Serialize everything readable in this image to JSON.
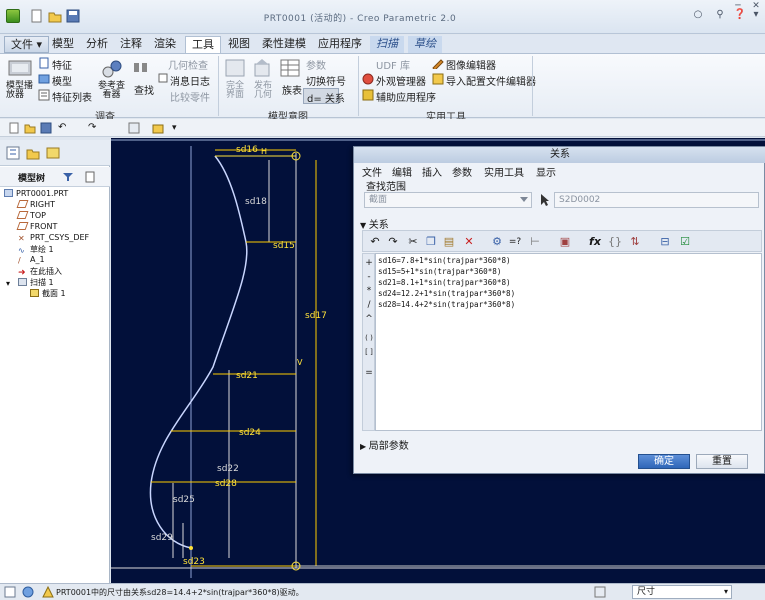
{
  "window": {
    "title": "PRT0001 (活动的) - Creo Parametric 2.0"
  },
  "ribbon_tabs": [
    {
      "label": "文件 ▾"
    },
    {
      "label": "模型"
    },
    {
      "label": "分析"
    },
    {
      "label": "注释"
    },
    {
      "label": "渲染"
    },
    {
      "label": "工具"
    },
    {
      "label": "视图"
    },
    {
      "label": "柔性建模"
    },
    {
      "label": "应用程序"
    },
    {
      "label": "扫描"
    },
    {
      "label": "草绘"
    }
  ],
  "ribbon": {
    "model_player": "模型播\n放器",
    "feature": "特征",
    "model": "模型",
    "feature_list": "特征列表",
    "reference_viewer": "参考查\n看器",
    "find": "查找",
    "geometry_check": "几何检查",
    "message_log": "消息日志",
    "compare_parts": "比较零件",
    "group_investigate": "调查",
    "complete_interface": "完全\n界面",
    "publish_geometry": "发布\n几何",
    "family_table": "族表",
    "parameters": "参数",
    "switch_symbols": "切换符号",
    "relations": "d= 关系",
    "group_model_intent": "模型意图",
    "udf_library": "UDF 库",
    "appearance_manager": "外观管理器",
    "auxiliary_app": "辅助应用程序",
    "image_editor": "图像编辑器",
    "import_config_editor": "导入配置文件编辑器",
    "group_utilities": "实用工具"
  },
  "model_tree": {
    "header": "模型树",
    "items": [
      {
        "label": "PRT0001.PRT"
      },
      {
        "label": "RIGHT"
      },
      {
        "label": "TOP"
      },
      {
        "label": "FRONT"
      },
      {
        "label": "PRT_CSYS_DEF"
      },
      {
        "label": "草绘 1"
      },
      {
        "label": "A_1"
      },
      {
        "label": "在此插入"
      },
      {
        "label": "扫描 1"
      },
      {
        "label": "截面 1"
      }
    ]
  },
  "sketch": {
    "dims": [
      "sd16",
      "sd18",
      "sd15",
      "sd17",
      "sd21",
      "sd24",
      "sd22",
      "sd28",
      "sd25",
      "sd29",
      "sd23"
    ],
    "labels": [
      "H",
      "V"
    ]
  },
  "dialog": {
    "title": "关系",
    "menu": [
      "文件",
      "编辑",
      "插入",
      "参数",
      "实用工具",
      "显示"
    ],
    "scope_label": "查找范围",
    "scope_value": "截面",
    "section_value": "S2D0002",
    "relations_label": "关系",
    "relations": [
      "sd16=7.8+1*sin(trajpar*360*8)",
      "sd15=5+1*sin(trajpar*360*8)",
      "sd21=8.1+1*sin(trajpar*360*8)",
      "sd24=12.2+1*sin(trajpar*360*8)",
      "sd28=14.4+2*sin(trajpar*360*8)"
    ],
    "local_params": "局部参数",
    "ok": "确定",
    "reset": "重置",
    "side_buttons": [
      "+",
      "-",
      "*",
      "/",
      "^",
      "( )",
      "[ ]",
      "="
    ]
  },
  "status": {
    "message": "PRT0001中的尺寸由关系sd28=14.4+2*sin(trajpar*360*8)驱动。",
    "filter": "尺寸"
  }
}
